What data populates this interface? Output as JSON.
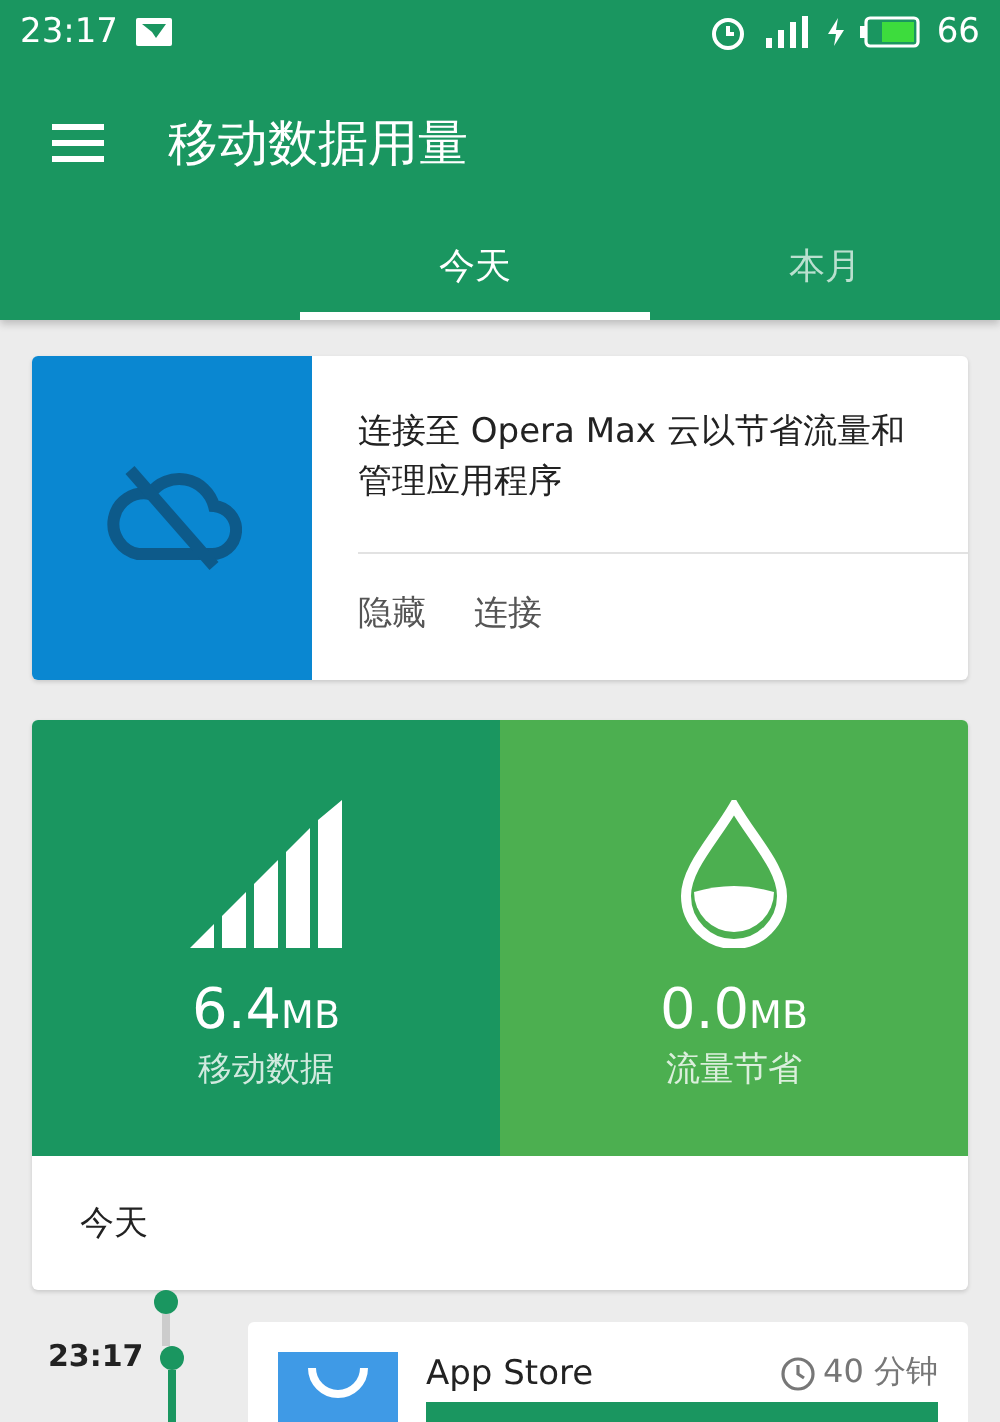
{
  "status_bar": {
    "time": "23:17",
    "battery": "66"
  },
  "toolbar": {
    "title": "移动数据用量"
  },
  "tabs": [
    {
      "label": "今天",
      "selected": true
    },
    {
      "label": "本月",
      "selected": false
    }
  ],
  "promo": {
    "text": "连接至 Opera Max 云以节省流量和管理应用程序",
    "actions": [
      "隐藏",
      "连接"
    ]
  },
  "stats": [
    {
      "kind": "signal",
      "value": "6.4",
      "unit": "MB",
      "label": "移动数据"
    },
    {
      "kind": "drop",
      "value": "0.0",
      "unit": "MB",
      "label": "流量节省"
    }
  ],
  "day_header": "今天",
  "timeline": [
    {
      "time": "23:17",
      "app": "App Store",
      "duration": "40 分钟"
    }
  ]
}
